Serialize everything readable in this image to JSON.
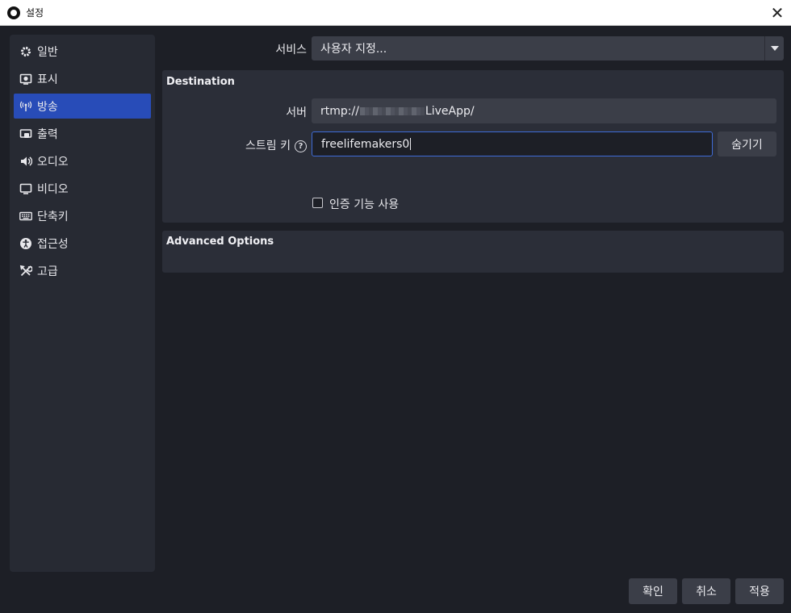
{
  "window": {
    "title": "설정",
    "close_glyph": "✕"
  },
  "sidebar": {
    "items": [
      {
        "label": "일반",
        "icon": "gear-icon"
      },
      {
        "label": "표시",
        "icon": "display-icon"
      },
      {
        "label": "방송",
        "icon": "broadcast-icon",
        "active": true
      },
      {
        "label": "출력",
        "icon": "output-icon"
      },
      {
        "label": "오디오",
        "icon": "speaker-icon"
      },
      {
        "label": "비디오",
        "icon": "monitor-icon"
      },
      {
        "label": "단축키",
        "icon": "keyboard-icon"
      },
      {
        "label": "접근성",
        "icon": "accessibility-icon"
      },
      {
        "label": "고급",
        "icon": "tools-icon"
      }
    ]
  },
  "service": {
    "label": "서비스",
    "value": "사용자 지정..."
  },
  "destination": {
    "title": "Destination",
    "server_label": "서버",
    "server_prefix": "rtmp://",
    "server_suffix": "LiveApp/",
    "stream_key_label": "스트림 키",
    "help_glyph": "?",
    "stream_key_value": "freelifemakers0",
    "hide_button": "숨기기",
    "auth_checkbox_label": "인증 기능 사용",
    "auth_checked": false
  },
  "advanced": {
    "title": "Advanced Options"
  },
  "footer": {
    "ok": "확인",
    "cancel": "취소",
    "apply": "적용"
  },
  "colors": {
    "accent": "#284cb8",
    "background": "#1d1f26",
    "panel": "#2b2e38",
    "focus": "#3e6bd6"
  }
}
